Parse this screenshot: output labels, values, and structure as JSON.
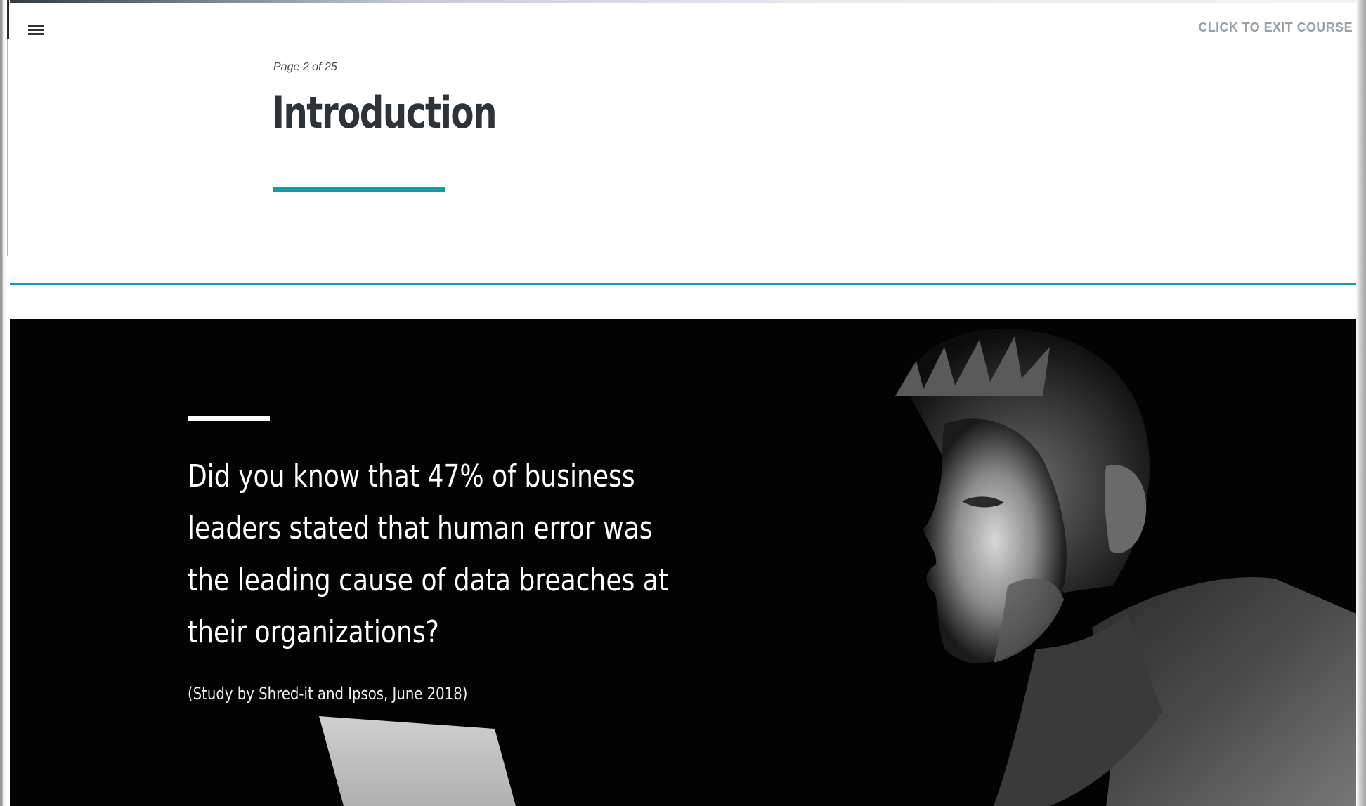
{
  "header": {
    "menu_icon": "hamburger-menu-icon",
    "exit_label": "CLICK TO EXIT COURSE"
  },
  "lesson": {
    "page_indicator": "Page 2 of 25",
    "title": "Introduction"
  },
  "hero": {
    "quote": "Did you know that 47% of business leaders stated that human error was the leading cause of data breaches at their organizations?",
    "citation": "(Study by Shred-it and Ipsos, June 2018)",
    "image_description_icon": "man-at-laptop-photo"
  },
  "colors": {
    "accent": "#1a98a8",
    "title": "#2e3338",
    "hero_background": "#030303",
    "hero_text": "#ffffff",
    "exit_text": "#9aa0a6"
  }
}
